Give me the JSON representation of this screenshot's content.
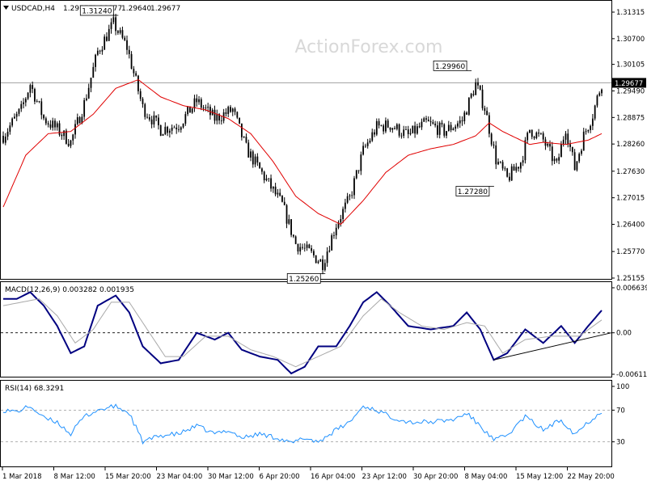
{
  "window": {
    "symbol_header": "USDCAD,H4",
    "ohlc": [
      "1.29777",
      "1.29877",
      "1.29640",
      "1.29677"
    ],
    "watermark": "ActionForex.com"
  },
  "colors": {
    "candles": "#000000",
    "ma": "#e00000",
    "macd": "#000080",
    "signal": "#a9a9a9",
    "rsi": "#1e90ff",
    "grid_line": "#888888",
    "background": "#ffffff"
  },
  "chart_data": [
    {
      "type": "candlestick",
      "panel": "price",
      "title": "USDCAD,H4",
      "x_tick_labels": [
        "1 Mar 2018",
        "8 Mar 12:00",
        "15 Mar 20:00",
        "23 Mar 04:00",
        "30 Mar 12:00",
        "6 Apr 20:00",
        "16 Apr 04:00",
        "23 Apr 12:00",
        "30 Apr 20:00",
        "8 May 04:00",
        "15 May 12:00",
        "22 May 20:00"
      ],
      "y_tick_labels": [
        "1.31315",
        "1.30700",
        "1.30105",
        "1.29490",
        "1.28875",
        "1.28260",
        "1.27630",
        "1.27015",
        "1.26400",
        "1.25770",
        "1.25155"
      ],
      "ylim": [
        1.25155,
        1.31315
      ],
      "current_price_label": "1.29677",
      "close_path": [
        {
          "i": 0,
          "y": 1.2845
        },
        {
          "i": 8,
          "y": 1.2905
        },
        {
          "i": 12,
          "y": 1.2965
        },
        {
          "i": 18,
          "y": 1.2885
        },
        {
          "i": 24,
          "y": 1.286
        },
        {
          "i": 30,
          "y": 1.283
        },
        {
          "i": 36,
          "y": 1.292
        },
        {
          "i": 42,
          "y": 1.304
        },
        {
          "i": 49,
          "y": 1.3105
        },
        {
          "i": 55,
          "y": 1.305
        },
        {
          "i": 62,
          "y": 1.291
        },
        {
          "i": 70,
          "y": 1.286
        },
        {
          "i": 78,
          "y": 1.287
        },
        {
          "i": 86,
          "y": 1.2925
        },
        {
          "i": 94,
          "y": 1.2885
        },
        {
          "i": 102,
          "y": 1.2905
        },
        {
          "i": 108,
          "y": 1.2815
        },
        {
          "i": 116,
          "y": 1.275
        },
        {
          "i": 124,
          "y": 1.2685
        },
        {
          "i": 130,
          "y": 1.2595
        },
        {
          "i": 136,
          "y": 1.2575
        },
        {
          "i": 142,
          "y": 1.255
        },
        {
          "i": 148,
          "y": 1.264
        },
        {
          "i": 154,
          "y": 1.27
        },
        {
          "i": 160,
          "y": 1.281
        },
        {
          "i": 166,
          "y": 1.2865
        },
        {
          "i": 172,
          "y": 1.287
        },
        {
          "i": 180,
          "y": 1.2845
        },
        {
          "i": 188,
          "y": 1.2875
        },
        {
          "i": 196,
          "y": 1.2855
        },
        {
          "i": 204,
          "y": 1.288
        },
        {
          "i": 210,
          "y": 1.2965
        },
        {
          "i": 214,
          "y": 1.291
        },
        {
          "i": 219,
          "y": 1.279
        },
        {
          "i": 224,
          "y": 1.2745
        },
        {
          "i": 230,
          "y": 1.2785
        },
        {
          "i": 234,
          "y": 1.286
        },
        {
          "i": 240,
          "y": 1.2835
        },
        {
          "i": 246,
          "y": 1.2775
        },
        {
          "i": 250,
          "y": 1.2865
        },
        {
          "i": 254,
          "y": 1.277
        },
        {
          "i": 258,
          "y": 1.2845
        },
        {
          "i": 262,
          "y": 1.2895
        },
        {
          "i": 266,
          "y": 1.2968
        }
      ],
      "moving_average": [
        {
          "i": 0,
          "y": 1.268
        },
        {
          "i": 10,
          "y": 1.28
        },
        {
          "i": 20,
          "y": 1.285
        },
        {
          "i": 30,
          "y": 1.2855
        },
        {
          "i": 40,
          "y": 1.2895
        },
        {
          "i": 50,
          "y": 1.2955
        },
        {
          "i": 60,
          "y": 1.2975
        },
        {
          "i": 70,
          "y": 1.2935
        },
        {
          "i": 80,
          "y": 1.2915
        },
        {
          "i": 90,
          "y": 1.2905
        },
        {
          "i": 100,
          "y": 1.2885
        },
        {
          "i": 110,
          "y": 1.285
        },
        {
          "i": 120,
          "y": 1.2785
        },
        {
          "i": 130,
          "y": 1.2705
        },
        {
          "i": 140,
          "y": 1.2665
        },
        {
          "i": 150,
          "y": 1.264
        },
        {
          "i": 160,
          "y": 1.2695
        },
        {
          "i": 170,
          "y": 1.276
        },
        {
          "i": 180,
          "y": 1.28
        },
        {
          "i": 190,
          "y": 1.2815
        },
        {
          "i": 200,
          "y": 1.2825
        },
        {
          "i": 210,
          "y": 1.2845
        },
        {
          "i": 216,
          "y": 1.2875
        },
        {
          "i": 222,
          "y": 1.2855
        },
        {
          "i": 228,
          "y": 1.284
        },
        {
          "i": 234,
          "y": 1.2825
        },
        {
          "i": 240,
          "y": 1.283
        },
        {
          "i": 250,
          "y": 1.2825
        },
        {
          "i": 260,
          "y": 1.2835
        },
        {
          "i": 266,
          "y": 1.285
        }
      ],
      "annotations": [
        {
          "text": "1.31240",
          "i": 49,
          "y": 1.3124,
          "side": "above"
        },
        {
          "text": "1.29960",
          "i": 206,
          "y": 1.2996,
          "side": "above"
        },
        {
          "text": "1.27280",
          "i": 216,
          "y": 1.2728,
          "side": "below"
        },
        {
          "text": "1.25260",
          "i": 141,
          "y": 1.2526,
          "side": "below"
        }
      ]
    },
    {
      "type": "line",
      "panel": "macd",
      "label": "MACD(12,26,9) 0.003282 0.001935",
      "y_tick_labels": [
        "0.006639",
        "0.00",
        "-0.006114"
      ],
      "ylim": [
        -0.006114,
        0.006639
      ],
      "series": [
        {
          "role": "macd",
          "points": [
            {
              "i": 0,
              "y": 0.005
            },
            {
              "i": 6,
              "y": 0.005
            },
            {
              "i": 12,
              "y": 0.006
            },
            {
              "i": 18,
              "y": 0.004
            },
            {
              "i": 24,
              "y": 0.001
            },
            {
              "i": 30,
              "y": -0.003
            },
            {
              "i": 36,
              "y": -0.002
            },
            {
              "i": 42,
              "y": 0.004
            },
            {
              "i": 50,
              "y": 0.0055
            },
            {
              "i": 56,
              "y": 0.003
            },
            {
              "i": 62,
              "y": -0.002
            },
            {
              "i": 70,
              "y": -0.0045
            },
            {
              "i": 78,
              "y": -0.004
            },
            {
              "i": 86,
              "y": 0.0
            },
            {
              "i": 94,
              "y": -0.001
            },
            {
              "i": 100,
              "y": 0.0
            },
            {
              "i": 106,
              "y": -0.0025
            },
            {
              "i": 114,
              "y": -0.0035
            },
            {
              "i": 122,
              "y": -0.004
            },
            {
              "i": 128,
              "y": -0.006
            },
            {
              "i": 134,
              "y": -0.005
            },
            {
              "i": 140,
              "y": -0.002
            },
            {
              "i": 148,
              "y": -0.002
            },
            {
              "i": 154,
              "y": 0.001
            },
            {
              "i": 160,
              "y": 0.0045
            },
            {
              "i": 166,
              "y": 0.006
            },
            {
              "i": 172,
              "y": 0.004
            },
            {
              "i": 180,
              "y": 0.001
            },
            {
              "i": 190,
              "y": 0.0005
            },
            {
              "i": 200,
              "y": 0.001
            },
            {
              "i": 206,
              "y": 0.003
            },
            {
              "i": 212,
              "y": 0.0005
            },
            {
              "i": 218,
              "y": -0.004
            },
            {
              "i": 224,
              "y": -0.003
            },
            {
              "i": 232,
              "y": 0.0005
            },
            {
              "i": 240,
              "y": -0.0015
            },
            {
              "i": 248,
              "y": 0.001
            },
            {
              "i": 254,
              "y": -0.0015
            },
            {
              "i": 260,
              "y": 0.001
            },
            {
              "i": 266,
              "y": 0.0033
            }
          ]
        },
        {
          "role": "signal",
          "points": [
            {
              "i": 0,
              "y": 0.004
            },
            {
              "i": 8,
              "y": 0.0045
            },
            {
              "i": 16,
              "y": 0.005
            },
            {
              "i": 24,
              "y": 0.0025
            },
            {
              "i": 32,
              "y": -0.0015
            },
            {
              "i": 40,
              "y": 0.0005
            },
            {
              "i": 48,
              "y": 0.0045
            },
            {
              "i": 56,
              "y": 0.0045
            },
            {
              "i": 64,
              "y": 0.0005
            },
            {
              "i": 72,
              "y": -0.0035
            },
            {
              "i": 80,
              "y": -0.0035
            },
            {
              "i": 90,
              "y": -0.0005
            },
            {
              "i": 100,
              "y": -0.0005
            },
            {
              "i": 110,
              "y": -0.0025
            },
            {
              "i": 120,
              "y": -0.0035
            },
            {
              "i": 130,
              "y": -0.005
            },
            {
              "i": 140,
              "y": -0.0035
            },
            {
              "i": 150,
              "y": -0.002
            },
            {
              "i": 160,
              "y": 0.0025
            },
            {
              "i": 168,
              "y": 0.005
            },
            {
              "i": 176,
              "y": 0.003
            },
            {
              "i": 186,
              "y": 0.001
            },
            {
              "i": 196,
              "y": 0.0005
            },
            {
              "i": 206,
              "y": 0.0015
            },
            {
              "i": 214,
              "y": 0.001
            },
            {
              "i": 222,
              "y": -0.003
            },
            {
              "i": 232,
              "y": -0.001
            },
            {
              "i": 244,
              "y": -0.0005
            },
            {
              "i": 256,
              "y": -0.0005
            },
            {
              "i": 266,
              "y": 0.0019
            }
          ]
        }
      ],
      "trendline": [
        {
          "i": 218,
          "y": -0.004
        },
        {
          "i": 266,
          "y": 0.0
        }
      ]
    },
    {
      "type": "line",
      "panel": "rsi",
      "label": "RSI(14) 68.3291",
      "y_tick_labels": [
        "100",
        "70",
        "30",
        "0"
      ],
      "ylim": [
        0,
        100
      ],
      "levels": [
        70,
        30
      ],
      "series": [
        {
          "role": "rsi",
          "points": [
            {
              "i": 0,
              "y": 70
            },
            {
              "i": 6,
              "y": 68
            },
            {
              "i": 12,
              "y": 75
            },
            {
              "i": 18,
              "y": 60
            },
            {
              "i": 24,
              "y": 55
            },
            {
              "i": 30,
              "y": 40
            },
            {
              "i": 36,
              "y": 62
            },
            {
              "i": 42,
              "y": 70
            },
            {
              "i": 50,
              "y": 75
            },
            {
              "i": 56,
              "y": 66
            },
            {
              "i": 62,
              "y": 30
            },
            {
              "i": 70,
              "y": 38
            },
            {
              "i": 78,
              "y": 40
            },
            {
              "i": 86,
              "y": 50
            },
            {
              "i": 94,
              "y": 40
            },
            {
              "i": 100,
              "y": 45
            },
            {
              "i": 106,
              "y": 35
            },
            {
              "i": 114,
              "y": 40
            },
            {
              "i": 122,
              "y": 35
            },
            {
              "i": 128,
              "y": 28
            },
            {
              "i": 134,
              "y": 35
            },
            {
              "i": 140,
              "y": 30
            },
            {
              "i": 148,
              "y": 45
            },
            {
              "i": 154,
              "y": 55
            },
            {
              "i": 160,
              "y": 75
            },
            {
              "i": 166,
              "y": 70
            },
            {
              "i": 172,
              "y": 62
            },
            {
              "i": 180,
              "y": 55
            },
            {
              "i": 190,
              "y": 55
            },
            {
              "i": 200,
              "y": 58
            },
            {
              "i": 206,
              "y": 66
            },
            {
              "i": 212,
              "y": 50
            },
            {
              "i": 218,
              "y": 32
            },
            {
              "i": 224,
              "y": 38
            },
            {
              "i": 232,
              "y": 62
            },
            {
              "i": 240,
              "y": 45
            },
            {
              "i": 248,
              "y": 58
            },
            {
              "i": 254,
              "y": 40
            },
            {
              "i": 260,
              "y": 55
            },
            {
              "i": 266,
              "y": 68
            }
          ]
        }
      ]
    }
  ]
}
